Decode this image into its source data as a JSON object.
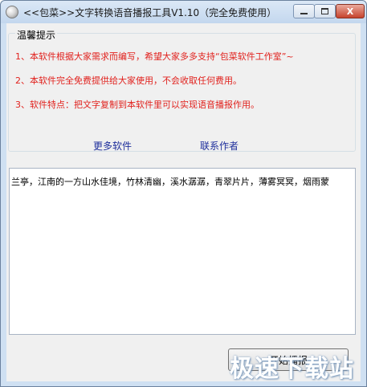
{
  "window": {
    "title": "<<包菜>>文字转换语音播报工具V1.10（完全免费使用）",
    "minimize_label": "",
    "maximize_label": "",
    "close_label": "X"
  },
  "notice": {
    "title": "温馨提示",
    "lines": [
      "1、本软件根据大家需求而编写，希望大家多多支持“包菜软件工作室”~",
      "2、本软件完全免费提供给大家使用，不会收取任何费用。",
      "3、软件特点：把文字复制到本软件里可以实现语音播报作用。"
    ]
  },
  "links": {
    "more_software": "更多软件",
    "contact_author": "联系作者"
  },
  "editor": {
    "content": "兰亭，江南的一方山水佳境，竹林清幽，溪水潺潺，青翠片片，薄雾冥冥，烟雨蒙"
  },
  "actions": {
    "start_label": "开始播报"
  },
  "watermark": "极速下载站",
  "colors": {
    "notice_text": "#e1211d",
    "link_text": "#1f2f9c",
    "titlebar": "#c3d7ee",
    "close_button": "#c7432d"
  }
}
